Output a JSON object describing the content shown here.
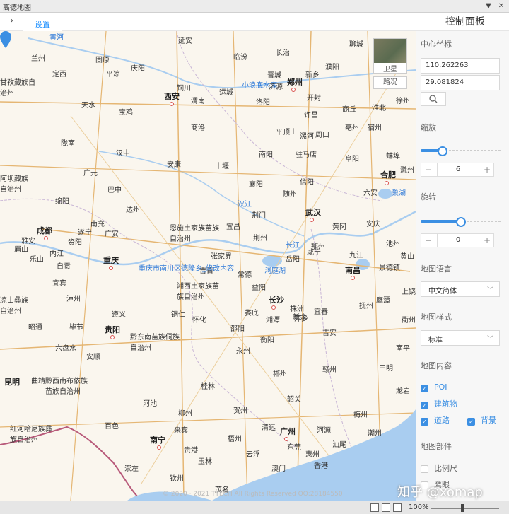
{
  "window": {
    "title": "高德地图"
  },
  "toolbar": {
    "tab_label": "设置",
    "panel_title": "控制面板"
  },
  "map": {
    "layers": {
      "satellite": "卫星",
      "road": "路况"
    },
    "marker_label": "重庆市南川区德隆乡_修改内容",
    "copyright": "© 2020 · 2021 TTECH All Rights Reserved QQ:28184550",
    "cities": {
      "c1": "兰州",
      "c2": "延安",
      "c3": "临汾",
      "c4": "长治",
      "c5": "聊城",
      "c6": "固原",
      "c7": "庆阳",
      "c8": "晋城",
      "c9": "濮阳",
      "c10": "新乡",
      "c11": "定西",
      "c12": "平凉",
      "c13": "铜川",
      "c14": "运城",
      "c15": "小浪底水库",
      "c16": "郑州",
      "c17": "西安",
      "c18": "渭南",
      "c19": "洛阳",
      "c20": "开封",
      "c21": "天水",
      "c22": "宝鸡",
      "c23": "许昌",
      "c24": "商丘",
      "c25": "商洛",
      "c26": "平顶山",
      "c27": "漯河",
      "c28": "周口",
      "c29": "亳州",
      "c30": "陇南",
      "c31": "汉中",
      "c32": "南阳",
      "c33": "驻马店",
      "c34": "阜阳",
      "c35": "蚌埠",
      "c36": "安康",
      "c37": "十堰",
      "c38": "广元",
      "c39": "信阳",
      "c40": "合肥",
      "c41": "巴中",
      "c42": "襄阳",
      "c43": "随州",
      "c44": "六安",
      "c45": "巢湖",
      "c46": "绵阳",
      "c47": "达州",
      "c48": "南充",
      "c49": "恩施土家族苗族自治州",
      "c50": "宜昌",
      "c51": "荆门",
      "c52": "武汉",
      "c53": "黄冈",
      "c54": "安庆",
      "c55": "成都",
      "c56": "遂宁",
      "c57": "广安",
      "c58": "荆州",
      "c59": "长江",
      "c60": "鄂州",
      "c61": "重庆",
      "c62": "咸宁",
      "c63": "岳阳",
      "c64": "九江",
      "c65": "景德镇",
      "c66": "乐山",
      "c67": "自贡",
      "c68": "常德",
      "c69": "洞庭湖",
      "c70": "南昌",
      "c71": "宜宾",
      "c72": "湘西土家族苗族自治州",
      "c73": "长沙",
      "c74": "上饶",
      "c75": "鹰潭",
      "c76": "遵义",
      "c77": "铜仁",
      "c78": "娄底",
      "c79": "宜春",
      "c80": "新余",
      "c81": "抚州",
      "c82": "昭通",
      "c83": "毕节",
      "c84": "贵阳",
      "c85": "怀化",
      "c86": "邵阳",
      "c87": "萍乡",
      "c88": "衡阳",
      "c89": "吉安",
      "c90": "黔东南苗族侗族自治州",
      "c91": "六盘水",
      "c92": "安顺",
      "c93": "永州",
      "c94": "赣州",
      "c95": "昆明",
      "c96": "曲靖",
      "c97": "黔西南布依族苗族自治州",
      "c98": "桂林",
      "c99": "郴州",
      "c100": "龙岩",
      "c101": "河池",
      "c102": "柳州",
      "c103": "贺州",
      "c104": "韶关",
      "c105": "梅州",
      "c106": "百色",
      "c107": "来宾",
      "c108": "梧州",
      "c109": "清远",
      "c110": "河源",
      "c111": "潮州",
      "c112": "红河哈尼族彝族自治州",
      "c113": "南宁",
      "c114": "贵港",
      "c115": "广州",
      "c116": "惠州",
      "c117": "汕尾",
      "c118": "崇左",
      "c119": "玉林",
      "c120": "云浮",
      "c121": "东莞",
      "c122": "澳门",
      "c123": "香港",
      "c124": "钦州",
      "c125": "茂名",
      "c126": "阿坝藏族自治州",
      "c127": "甘孜藏族自治州",
      "c128": "凉山彝族自治州",
      "c129": "济源",
      "c130": "徐州",
      "c131": "宿州",
      "c132": "淮北",
      "c133": "滁州",
      "c134": "池州",
      "c135": "黄山",
      "c136": "衢州",
      "c137": "南平",
      "c138": "三明",
      "c139": "泸州",
      "c140": "黄河",
      "c141": "雅安",
      "c142": "内江",
      "c143": "眉山",
      "c144": "资阳",
      "c145": "吉首",
      "c146": "张家界",
      "c147": "益阳",
      "c148": "株洲",
      "c149": "湘潭",
      "c150": "汉江"
    }
  },
  "panel": {
    "center_label": "中心坐标",
    "lng": "110.262263",
    "lat": "29.081824",
    "zoom_label": "缩放",
    "zoom_value": "6",
    "zoom_fraction": 0.24,
    "rotate_label": "旋转",
    "rotate_value": "0",
    "rotate_fraction": 0.5,
    "lang_label": "地图语言",
    "lang_value": "中文简体",
    "style_label": "地图样式",
    "style_value": "标准",
    "content_label": "地图内容",
    "poi": "POI",
    "buildings": "建筑物",
    "roads": "道路",
    "background": "背景",
    "parts_label": "地图部件",
    "scale": "比例尺",
    "eagle": "鹰眼"
  },
  "statusbar": {
    "zoom": "100%"
  },
  "watermark": "知乎 @xomap"
}
